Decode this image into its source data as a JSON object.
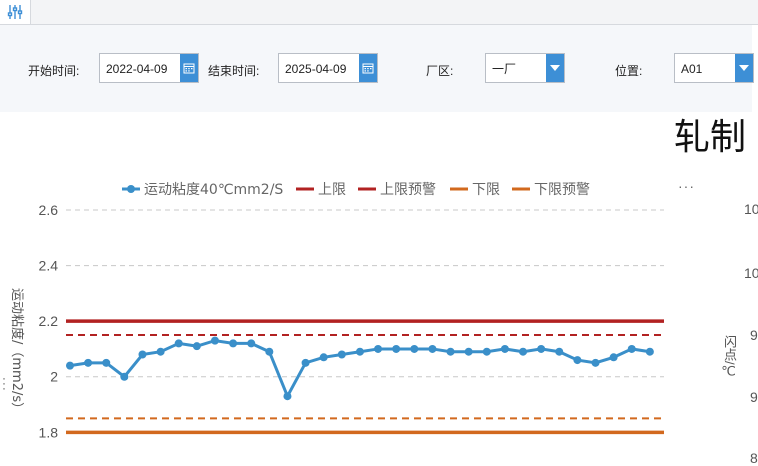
{
  "filters": {
    "start_label": "开始时间:",
    "start_value": "2022-04-09",
    "end_label": "结束时间:",
    "end_value": "2025-04-09",
    "area_label": "厂区:",
    "area_value": "一厂",
    "position_label": "位置:",
    "position_value": "A01"
  },
  "second_chart": {
    "title_partial": "轧制",
    "more_label": "···",
    "y_label": "闪点/℃",
    "y_ticks_partial": [
      "10",
      "10",
      "9",
      "9",
      "8"
    ]
  },
  "colors": {
    "accent": "#3d8fd6",
    "series": "#3a8fc9",
    "upper": "#b22222",
    "lower": "#d2691e"
  },
  "chart_data": {
    "type": "line",
    "legend": [
      "运动粘度40℃mm2/S",
      "上限",
      "上限预警",
      "下限",
      "下限预警"
    ],
    "ylabel": "运动粘度/（mm2/s）",
    "ylim": [
      1.7,
      2.6
    ],
    "yticks": [
      "2.6",
      "2.4",
      "2.2",
      "2",
      "1.8"
    ],
    "grid": true,
    "legend_position": "top",
    "series": [
      {
        "name": "运动粘度40℃mm2/S",
        "values": [
          2.04,
          2.05,
          2.05,
          2.0,
          2.08,
          2.09,
          2.12,
          2.11,
          2.13,
          2.12,
          2.12,
          2.09,
          1.93,
          2.05,
          2.07,
          2.08,
          2.09,
          2.1,
          2.1,
          2.1,
          2.1,
          2.09,
          2.09,
          2.09,
          2.1,
          2.09,
          2.1,
          2.09,
          2.06,
          2.05,
          2.07,
          2.1,
          2.09
        ]
      },
      {
        "name": "上限",
        "value": 2.2
      },
      {
        "name": "上限预警",
        "value": 2.15
      },
      {
        "name": "下限",
        "value": 1.8
      },
      {
        "name": "下限预警",
        "value": 1.85
      }
    ]
  }
}
